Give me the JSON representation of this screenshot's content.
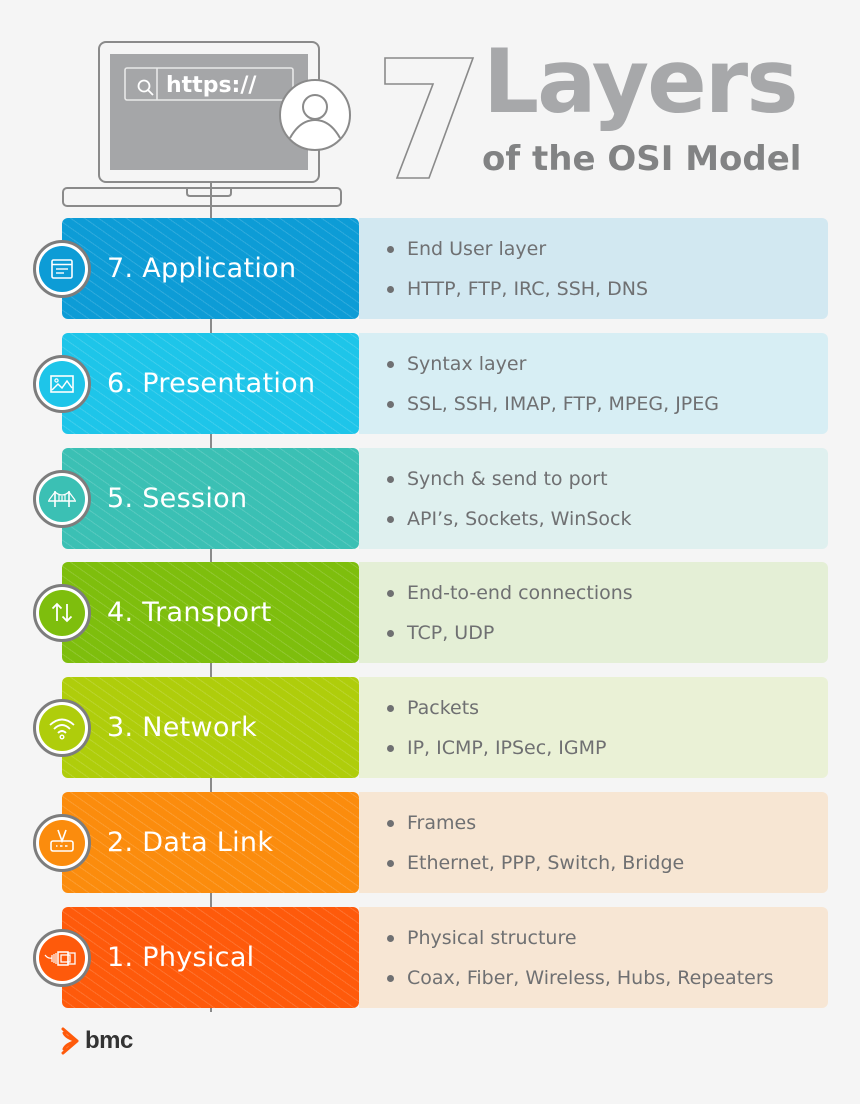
{
  "header": {
    "url_text": "https://",
    "title_number": "7",
    "title_main": "Layers",
    "title_sub": "of the OSI Model",
    "icons": [
      "search-icon",
      "user-avatar-icon",
      "laptop-icon"
    ]
  },
  "layers": [
    {
      "name": "7. Application",
      "icon": "browser-window-icon",
      "color": "#0d9cd6",
      "light_color": "#d2e8f1",
      "bullets": [
        "End User layer",
        "HTTP, FTP, IRC, SSH, DNS"
      ]
    },
    {
      "name": "6. Presentation",
      "icon": "image-icon",
      "color": "#1ec5e9",
      "light_color": "#d7eef4",
      "bullets": [
        "Syntax layer",
        "SSL, SSH, IMAP, FTP, MPEG, JPEG"
      ]
    },
    {
      "name": "5. Session",
      "icon": "bridge-icon",
      "color": "#3bc0b4",
      "light_color": "#dff0ef",
      "bullets": [
        "Synch & send to port",
        "API’s, Sockets, WinSock"
      ]
    },
    {
      "name": "4. Transport",
      "icon": "up-down-arrows-icon",
      "color": "#7ebe0d",
      "light_color": "#e4efd6",
      "bullets": [
        "End-to-end connections",
        "TCP, UDP"
      ]
    },
    {
      "name": "3. Network",
      "icon": "wifi-icon",
      "color": "#afcd0b",
      "light_color": "#eaf1d6",
      "bullets": [
        "Packets",
        "IP, ICMP, IPSec, IGMP"
      ]
    },
    {
      "name": "2. Data Link",
      "icon": "router-icon",
      "color": "#fb8c0d",
      "light_color": "#f7e6d3",
      "bullets": [
        "Frames",
        "Ethernet, PPP, Switch, Bridge"
      ]
    },
    {
      "name": "1. Physical",
      "icon": "cable-connector-icon",
      "color": "#fe5a0b",
      "light_color": "#f7e6d4",
      "bullets": [
        "Physical structure",
        "Coax, Fiber, Wireless, Hubs, Repeaters"
      ]
    }
  ],
  "footer": {
    "brand": "bmc",
    "brand_color": "#fe5a0b"
  }
}
